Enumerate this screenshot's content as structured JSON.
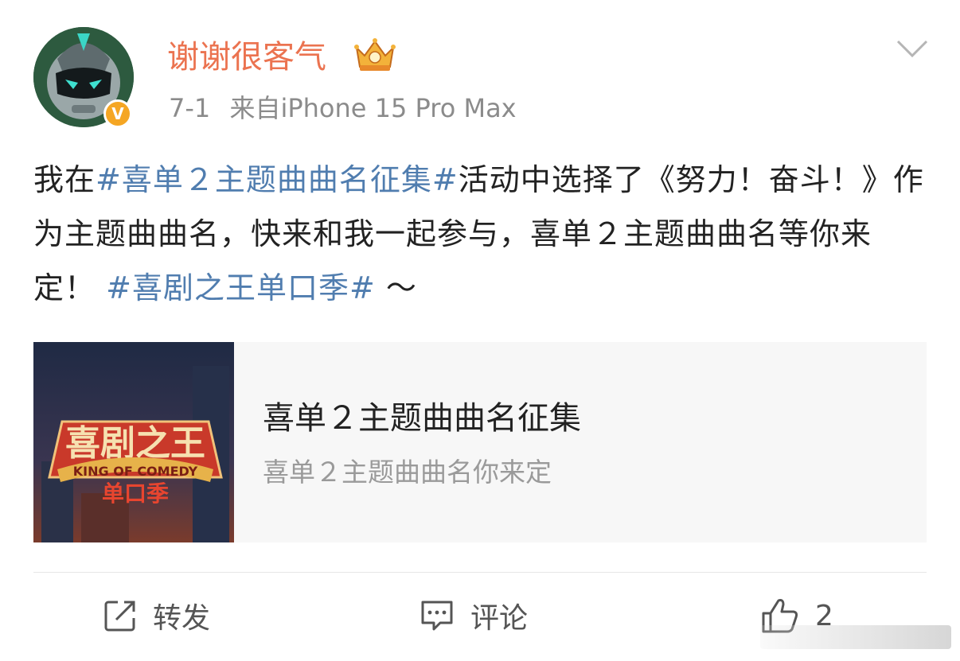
{
  "post": {
    "username": "谢谢很客气",
    "date": "7-1",
    "source": "来自iPhone 15 Pro Max",
    "text_segments": {
      "s1": "我在",
      "h1": "#喜单２主题曲曲名征集#",
      "s2": "活动中选择了《努力！奋斗！》作为主题曲曲名，快来和我一起参与，喜单２主题曲曲名等你来定！",
      "h2": "#喜剧之王单口季#",
      "s3": "～"
    }
  },
  "card": {
    "title": "喜单２主题曲曲名征集",
    "subtitle": "喜单２主题曲曲名你来定",
    "thumb_logo_text": "KING OF COMEDY"
  },
  "actions": {
    "repost_label": "转发",
    "comment_label": "评论",
    "like_count": "2"
  },
  "colors": {
    "username": "#eb7350",
    "hashtag": "#507daf",
    "meta": "#8b8b8b",
    "verified_badge": "#f5a623"
  },
  "icons": {
    "verified": "verified-v-icon",
    "crown": "crown-badge-icon",
    "menu": "chevron-down-icon",
    "repost": "repost-icon",
    "comment": "comment-icon",
    "like": "thumbs-up-icon"
  }
}
